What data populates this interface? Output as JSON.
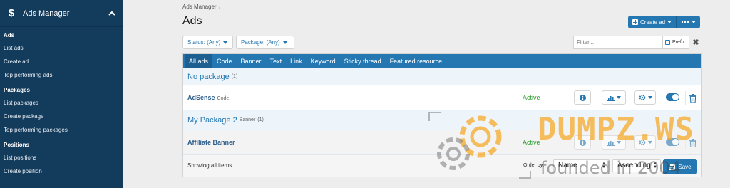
{
  "sidebar": {
    "title": "Ads Manager",
    "dollar": "$",
    "sections": [
      {
        "heading": "Ads",
        "links": [
          "List ads",
          "Create ad",
          "Top performing ads"
        ]
      },
      {
        "heading": "Packages",
        "links": [
          "List packages",
          "Create package",
          "Top performing packages"
        ]
      },
      {
        "heading": "Positions",
        "links": [
          "List positions",
          "Create position"
        ]
      }
    ]
  },
  "breadcrumb": {
    "item": "Ads Manager",
    "sep": "›"
  },
  "page": {
    "title": "Ads"
  },
  "header": {
    "create_label": "Create ad"
  },
  "filters": {
    "status_label": "Status: (Any)",
    "package_label": "Package: (Any)",
    "search_placeholder": "Filter...",
    "prefix_label": "Prefix",
    "clear": "✖"
  },
  "tabs": [
    "All ads",
    "Code",
    "Banner",
    "Text",
    "Link",
    "Keyword",
    "Sticky thread",
    "Featured resource"
  ],
  "groups": [
    {
      "name": "No package",
      "count": "(1)",
      "ads": [
        {
          "name": "AdSense",
          "type": "Code",
          "status": "Active"
        }
      ]
    },
    {
      "name": "My Package 2",
      "type": "Banner",
      "count": "(1)",
      "ads": [
        {
          "name": "Affiliate Banner",
          "type": "",
          "status": "Active"
        }
      ]
    }
  ],
  "footer": {
    "showing": "Showing all items",
    "order_by": "Order by:",
    "order_field": "Name",
    "order_dir": "Ascending",
    "save": "Save"
  },
  "watermark": {
    "text": "DUMPZ.WS",
    "sub": "founded in 2004"
  },
  "colors": {
    "accent": "#2577b1",
    "sidebar": "#133b5c",
    "active": "#2a9a2a",
    "danger": "#2577b1"
  }
}
